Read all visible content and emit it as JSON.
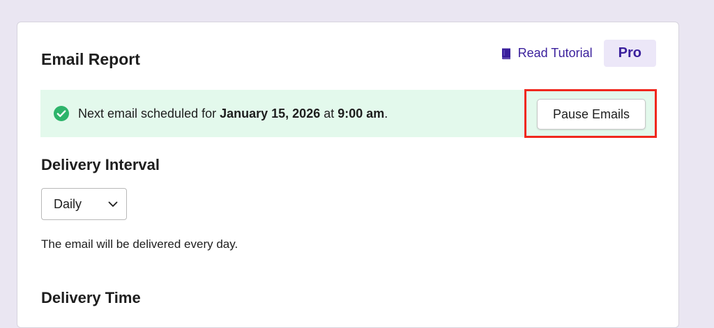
{
  "card": {
    "title": "Email Report",
    "tutorial_label": "Read Tutorial",
    "pro_badge": "Pro"
  },
  "notice": {
    "prefix": "Next email scheduled for ",
    "date": "January 15, 2026",
    "middle": " at ",
    "time": "9:00 am",
    "suffix": ".",
    "icon": "check-circle-icon",
    "status_color": "#2db46b"
  },
  "actions": {
    "pause_label": "Pause Emails"
  },
  "delivery_interval": {
    "heading": "Delivery Interval",
    "selected": "Daily",
    "helper": "The email will be delivered every day."
  },
  "delivery_time": {
    "heading": "Delivery Time"
  },
  "colors": {
    "accent": "#3a1f9c",
    "badge_bg": "#ece7f8",
    "notice_bg": "#e3f9ec",
    "highlight": "#f0281e",
    "page_bg": "#eae6f2"
  }
}
